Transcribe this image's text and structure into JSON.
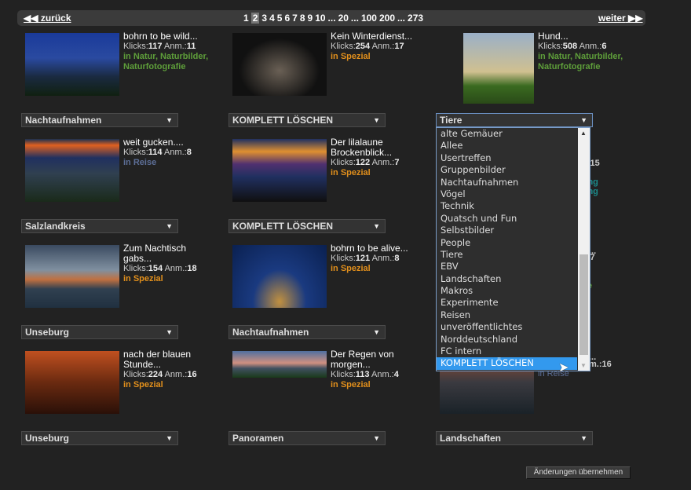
{
  "nav": {
    "prev": "zurück",
    "next": "weiter",
    "pages": [
      "1",
      "2",
      "3",
      "4",
      "5",
      "6",
      "7",
      "8",
      "9",
      "10",
      "...",
      "20",
      "...",
      "100",
      "200",
      "...",
      "273"
    ],
    "current": "2"
  },
  "items": [
    {
      "title": "bohrn to be wild...",
      "klicks": "117",
      "anm": "11",
      "cat": "in Natur, Naturbilder, Naturfotografie",
      "catColor": "#5e9e3a",
      "select": "Nachtaufnahmen"
    },
    {
      "title": "Kein Winterdienst...",
      "klicks": "254",
      "anm": "17",
      "cat": "in Spezial",
      "catColor": "#e3901c",
      "select": "KOMPLETT LÖSCHEN"
    },
    {
      "title": "Hund...",
      "klicks": "508",
      "anm": "6",
      "cat": "in Natur, Naturbilder, Naturfotografie",
      "catColor": "#5e9e3a",
      "select": "Tiere"
    },
    {
      "title": "weit gucken....",
      "klicks": "114",
      "anm": "8",
      "cat": "in Reise",
      "catColor": "#5d6f98",
      "select": "Salzlandkreis"
    },
    {
      "title": "Der lilalaune Brockenblick...",
      "klicks": "122",
      "anm": "7",
      "cat": "in Spezial",
      "catColor": "#e3901c",
      "select": "KOMPLETT LÖSCHEN"
    },
    {
      "title": "Zum Nachtisch gabs...",
      "klicks": "154",
      "anm": "18",
      "cat": "in Spezial",
      "catColor": "#e3901c",
      "select": "Unseburg"
    },
    {
      "title": "bohrn to be alive...",
      "klicks": "121",
      "anm": "8",
      "cat": "in Spezial",
      "catColor": "#e3901c",
      "select": "Nachtaufnahmen"
    },
    {
      "title": "nach der blauen Stunde...",
      "klicks": "224",
      "anm": "16",
      "cat": "in Spezial",
      "catColor": "#e3901c",
      "select": "Unseburg"
    },
    {
      "title": "Der Regen von morgen...",
      "klicks": "113",
      "anm": "4",
      "cat": "in Spezial",
      "catColor": "#e3901c",
      "select": "Panoramen"
    }
  ],
  "hidden_fragments": {
    "r2_anm": "m.:15",
    "r2_cat1": "itung",
    "r2_cat2": "itung",
    "r3_title": "...",
    "r3_anm": "m.:7",
    "r3_cat": "afie",
    "r4_title": "...",
    "r4_anm": "m.:16",
    "r4_cat": "in Reise",
    "r4_select": "Landschaften"
  },
  "labels": {
    "klicks": "Klicks:",
    "anm": "Anm.:"
  },
  "dropdown": {
    "options": [
      "alte Gemäuer",
      "Allee",
      "Usertreffen",
      "Gruppenbilder",
      "Nachtaufnahmen",
      "Vögel",
      "Technik",
      "Quatsch und Fun",
      "Selbstbilder",
      "People",
      "Tiere",
      "EBV",
      "Landschaften",
      "Makros",
      "Experimente",
      "Reisen",
      "unveröffentlichtes",
      "Norddeutschland",
      "FC intern",
      "KOMPLETT LÖSCHEN"
    ],
    "highlighted": "KOMPLETT LÖSCHEN"
  },
  "apply_button": "Änderungen übernehmen"
}
